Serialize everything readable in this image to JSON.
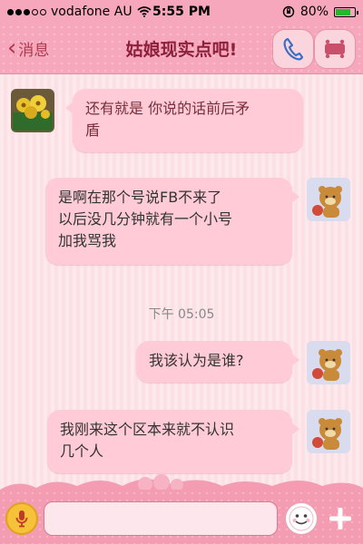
{
  "status_bar": {
    "carrier": "vodafone AU",
    "time": "5:55 PM",
    "battery_percent": "80%",
    "battery_level": 0.8,
    "signal_icon": "signal-dots-icon",
    "wifi_icon": "wifi-icon"
  },
  "nav": {
    "back_label": "消息",
    "title": "姑娘现实点吧!",
    "call_icon": "phone-icon",
    "profile_icon": "contact-card-icon"
  },
  "messages": [
    {
      "direction": "incoming",
      "text_line1": "还有就是 你说的话前后矛",
      "text_line2": "盾"
    },
    {
      "direction": "outgoing",
      "text_line1": "是啊在那个号说FB不来了",
      "text_line2": "以后没几分钟就有一个小号",
      "text_line3": "加我骂我"
    },
    {
      "direction": "outgoing",
      "text_line1": "我该认为是谁?"
    },
    {
      "direction": "outgoing",
      "text_line1": "我刚来这个区本来就不认识",
      "text_line2": "几个人"
    }
  ],
  "timestamp": "下午 05:05",
  "input_bar": {
    "message_value": "",
    "placeholder": ""
  },
  "colors": {
    "header": "#f6a7bb",
    "bubble": "#fecbd6",
    "title": "#8e1f3a"
  }
}
